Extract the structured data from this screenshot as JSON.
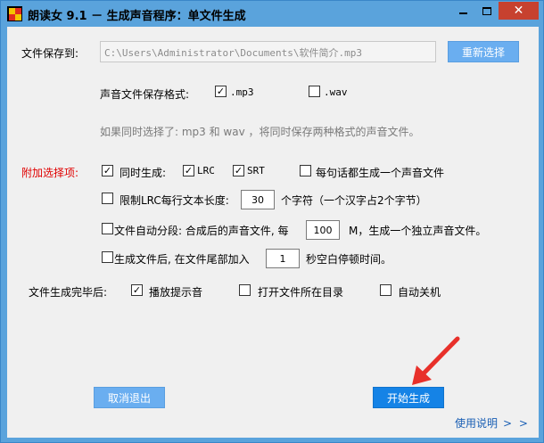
{
  "window": {
    "title": "朗读女 9.1 － 生成声音程序：单文件生成",
    "close_glyph": "✕"
  },
  "save_to": {
    "label": "文件保存到:",
    "path": "C:\\Users\\Administrator\\Documents\\软件简介.mp3",
    "reselect_button": "重新选择"
  },
  "format": {
    "label": "声音文件保存格式:",
    "mp3": {
      "label": ".mp3",
      "checked": true
    },
    "wav": {
      "label": ".wav",
      "checked": false
    },
    "hint": "如果同时选择了: mp3 和 wav ，将同时保存两种格式的声音文件。"
  },
  "extra": {
    "label": "附加选择项:",
    "simultaneous": {
      "label": "同时生成:",
      "checked": true
    },
    "lrc": {
      "label": "LRC",
      "checked": true
    },
    "srt": {
      "label": "SRT",
      "checked": true
    },
    "per_sentence": {
      "label": "每句话都生成一个声音文件",
      "checked": false
    },
    "limit_lrc": {
      "label": "限制LRC每行文本长度:",
      "checked": false,
      "value": "30",
      "suffix": "个字符（一个汉字占2个字节）"
    },
    "auto_split": {
      "label": "文件自动分段: 合成后的声音文件, 每",
      "checked": false,
      "value": "100",
      "suffix": "M，生成一个独立声音文件。"
    },
    "append_silence": {
      "label": "生成文件后, 在文件尾部加入",
      "checked": false,
      "value": "1",
      "suffix": "秒空白停顿时间。"
    }
  },
  "after_done": {
    "label": "文件生成完毕后:",
    "play_sound": {
      "label": "播放提示音",
      "checked": true
    },
    "open_folder": {
      "label": "打开文件所在目录",
      "checked": false
    },
    "shutdown": {
      "label": "自动关机",
      "checked": false
    }
  },
  "buttons": {
    "cancel": "取消退出",
    "start": "开始生成"
  },
  "help": {
    "label": "使用说明",
    "chevrons": "> >"
  },
  "colors": {
    "title_bar": "#5aa3dc",
    "close_button": "#c7412f",
    "accent_button": "#1583e6",
    "light_button": "#6aaef0",
    "section_label_red": "#e00000",
    "link": "#1a5fb4"
  }
}
